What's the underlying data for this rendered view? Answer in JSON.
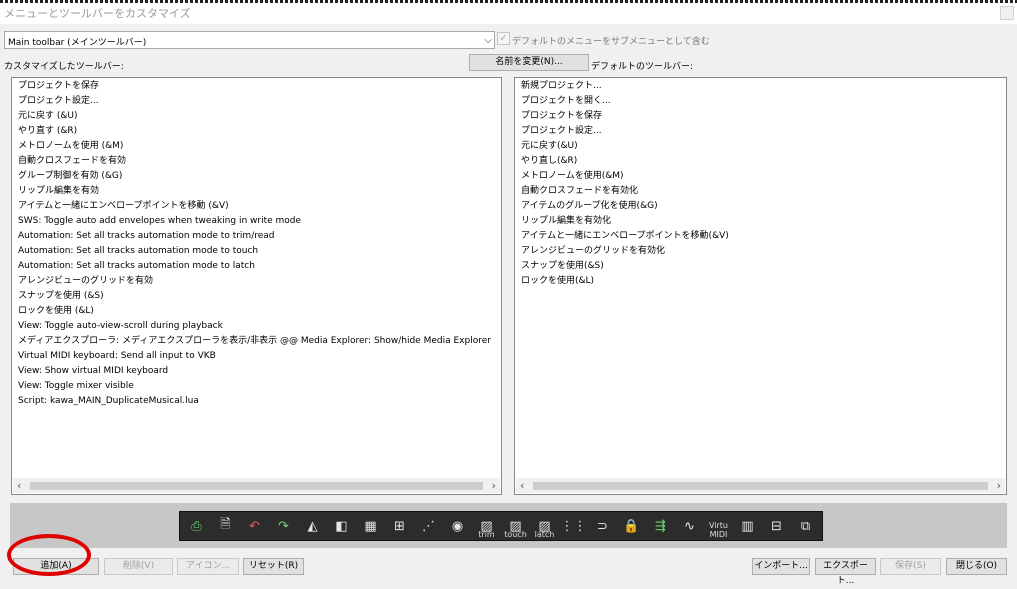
{
  "window": {
    "title": "メニューとツールバーをカスタマイズ"
  },
  "toolbar_select": {
    "value": "Main toolbar (メインツールバー)"
  },
  "include_default": {
    "label": "デフォルトのメニューをサブメニューとして含む",
    "checked": true
  },
  "labels": {
    "customized": "カスタマイズしたツールバー:",
    "default": "デフォルトのツールバー:"
  },
  "buttons": {
    "rename": "名前を変更(N)...",
    "add": "追加(A)",
    "delete": "削除(V)",
    "icon": "アイコン...",
    "reset": "リセット(R)",
    "import": "インポート...",
    "export": "エクスポート...",
    "save": "保存(S)",
    "close": "閉じる(O)"
  },
  "custom_items": [
    "プロジェクトを保存",
    "プロジェクト設定...",
    "元に戻す (&U)",
    "やり直す (&R)",
    "メトロノームを使用 (&M)",
    "自動クロスフェードを有効",
    "グループ制御を有効 (&G)",
    "リップル編集を有効",
    "アイテムと一緒にエンベロープポイントを移動 (&V)",
    "SWS: Toggle auto add envelopes when tweaking in write mode",
    "Automation: Set all tracks automation mode to trim/read",
    "Automation: Set all tracks automation mode to touch",
    "Automation: Set all tracks automation mode to latch",
    "アレンジビューのグリッドを有効",
    "スナップを使用 (&S)",
    "ロックを使用 (&L)",
    "View: Toggle auto-view-scroll during playback",
    "メディアエクスプローラ: メディアエクスプローラを表示/非表示 @@ Media Explorer: Show/hide Media Explorer",
    "Virtual MIDI keyboard: Send all input to VKB",
    "View: Show virtual MIDI keyboard",
    "View: Toggle mixer visible",
    "Script: kawa_MAIN_DuplicateMusical.lua"
  ],
  "default_items": [
    "新規プロジェクト...",
    "プロジェクトを開く...",
    "プロジェクトを保存",
    "プロジェクト設定...",
    "元に戻す(&U)",
    "やり直し(&R)",
    "メトロノームを使用(&M)",
    "自動クロスフェードを有効化",
    "アイテムのグループ化を使用(&G)",
    "リップル編集を有効化",
    "アイテムと一緒にエンベロープポイントを移動(&V)",
    "アレンジビューのグリッドを有効化",
    "スナップを使用(&S)",
    "ロックを使用(&L)"
  ],
  "toolbar_icons": [
    {
      "name": "save-project-icon",
      "glyph": "⎙"
    },
    {
      "name": "project-settings-icon",
      "glyph": "🗎"
    },
    {
      "name": "undo-icon",
      "glyph": "↶"
    },
    {
      "name": "redo-icon",
      "glyph": "↷"
    },
    {
      "name": "metronome-icon",
      "glyph": "◭"
    },
    {
      "name": "auto-crossfade-icon",
      "glyph": "◧"
    },
    {
      "name": "group-icon",
      "glyph": "▦"
    },
    {
      "name": "ripple-edit-icon",
      "glyph": "⊞"
    },
    {
      "name": "envelope-move-icon",
      "glyph": "⋰"
    },
    {
      "name": "auto-add-envelope-icon",
      "glyph": "◉"
    },
    {
      "name": "trim-icon",
      "glyph": "▨",
      "caption": "trim"
    },
    {
      "name": "touch-icon",
      "glyph": "▨",
      "caption": "touch"
    },
    {
      "name": "latch-icon",
      "glyph": "▨",
      "caption": "latch"
    },
    {
      "name": "grid-icon",
      "glyph": "⋮⋮"
    },
    {
      "name": "snap-icon",
      "glyph": "⊃"
    },
    {
      "name": "lock-icon",
      "glyph": "🔒"
    },
    {
      "name": "auto-scroll-icon",
      "glyph": "⇶"
    },
    {
      "name": "media-explorer-icon",
      "glyph": "∿"
    },
    {
      "name": "virtual-midi-send-icon",
      "glyph": "",
      "caption": "Virtu MIDI"
    },
    {
      "name": "midi-keyboard-icon",
      "glyph": "▥"
    },
    {
      "name": "mixer-icon",
      "glyph": "⊟"
    },
    {
      "name": "duplicate-musical-icon",
      "glyph": "⧉"
    }
  ]
}
